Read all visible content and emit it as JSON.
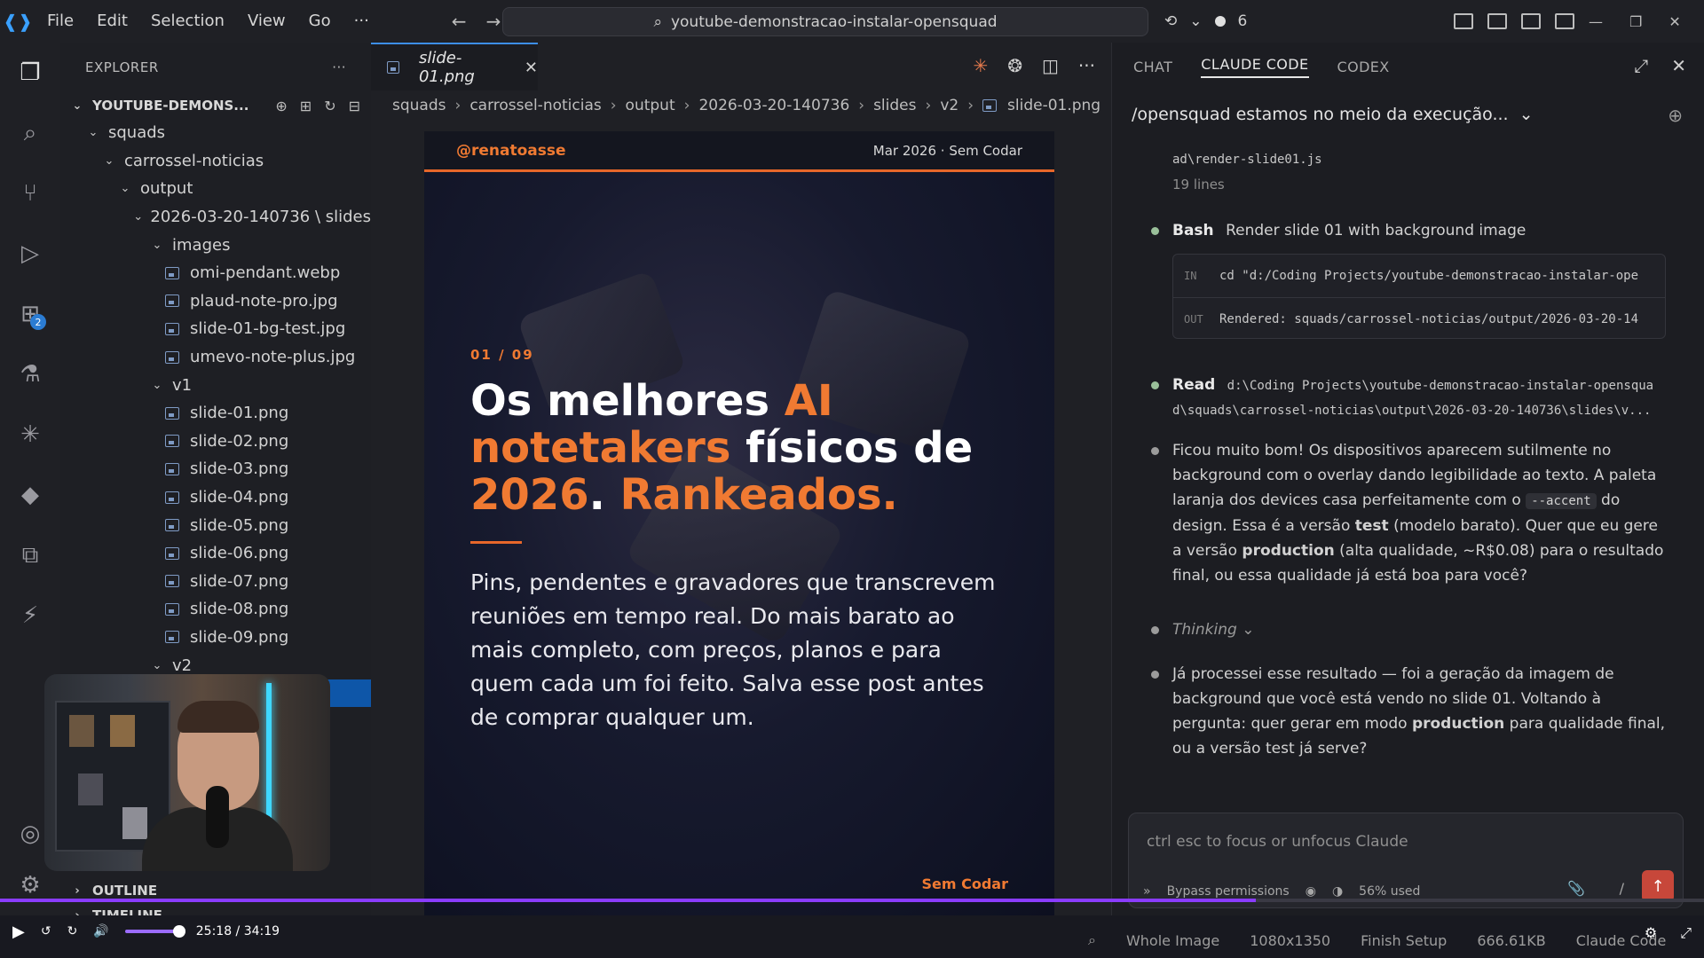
{
  "titlebar": {
    "menu": [
      "File",
      "Edit",
      "Selection",
      "View",
      "Go",
      "···"
    ],
    "search": "youtube-demonstracao-instalar-opensquad",
    "notifications": "6"
  },
  "explorer": {
    "title": "EXPLORER",
    "more": "···",
    "root": "YOUTUBE-DEMONS...",
    "tree": [
      {
        "label": "squads",
        "indent": 1,
        "kind": "folder"
      },
      {
        "label": "carrossel-noticias",
        "indent": 2,
        "kind": "folder"
      },
      {
        "label": "output",
        "indent": 3,
        "kind": "folder"
      },
      {
        "label": "2026-03-20-140736 \\ slides",
        "indent": 4,
        "kind": "folder"
      },
      {
        "label": "images",
        "indent": 5,
        "kind": "folder"
      },
      {
        "label": "omi-pendant.webp",
        "indent": 6,
        "kind": "file"
      },
      {
        "label": "plaud-note-pro.jpg",
        "indent": 6,
        "kind": "file"
      },
      {
        "label": "slide-01-bg-test.jpg",
        "indent": 6,
        "kind": "file"
      },
      {
        "label": "umevo-note-plus.jpg",
        "indent": 6,
        "kind": "file"
      },
      {
        "label": "v1",
        "indent": 5,
        "kind": "folder"
      },
      {
        "label": "slide-01.png",
        "indent": 6,
        "kind": "file"
      },
      {
        "label": "slide-02.png",
        "indent": 6,
        "kind": "file"
      },
      {
        "label": "slide-03.png",
        "indent": 6,
        "kind": "file"
      },
      {
        "label": "slide-04.png",
        "indent": 6,
        "kind": "file"
      },
      {
        "label": "slide-05.png",
        "indent": 6,
        "kind": "file"
      },
      {
        "label": "slide-06.png",
        "indent": 6,
        "kind": "file"
      },
      {
        "label": "slide-07.png",
        "indent": 6,
        "kind": "file"
      },
      {
        "label": "slide-08.png",
        "indent": 6,
        "kind": "file"
      },
      {
        "label": "slide-09.png",
        "indent": 6,
        "kind": "file"
      },
      {
        "label": "v2",
        "indent": 5,
        "kind": "folder"
      }
    ],
    "outline": "OUTLINE",
    "timeline": "TIMELINE"
  },
  "editor": {
    "tab": "slide-01.png",
    "breadcrumb": [
      "squads",
      "carrossel-noticias",
      "output",
      "2026-03-20-140736",
      "slides",
      "v2",
      "slide-01.png"
    ]
  },
  "slide": {
    "handle": "@renatoasse",
    "date": "Mar 2026 · Sem Codar",
    "counter": "01 / 09",
    "headline": {
      "p1": "Os melhores ",
      "a1": "AI",
      "a2": "notetakers",
      "p2": " físicos de",
      "a3": "2026",
      "p3": ". ",
      "a4": "Rankeados."
    },
    "body": "Pins, pendentes e gravadores que transcrevem reuniões em tempo real. Do mais barato ao mais completo, com preços, planos e para quem cada um foi feito. Salva esse post antes de comprar qualquer um.",
    "footer": "Sem Codar"
  },
  "chat": {
    "tabs": [
      "CHAT",
      "CLAUDE CODE",
      "CODEX"
    ],
    "session_title": "/opensquad estamos no meio da execução...",
    "msg0": {
      "path": "ad\\render-slide01.js",
      "meta": "19 lines"
    },
    "msg1": {
      "tool": "Bash",
      "desc": "Render slide 01 with background image",
      "in_tag": "IN",
      "in_cmd": "cd \"d:/Coding Projects/youtube-demonstracao-instalar-ope",
      "out_tag": "OUT",
      "out_text": "Rendered: squads/carrossel-noticias/output/2026-03-20-14"
    },
    "msg2": {
      "tool": "Read",
      "path": "d:\\Coding Projects\\youtube-demonstracao-instalar-opensqua",
      "path2": "d\\squads\\carrossel-noticias\\output\\2026-03-20-140736\\slides\\v..."
    },
    "msg3": {
      "t1": "Ficou muito bom! Os dispositivos aparecem sutilmente no background com o overlay dando legibilidade ao texto. A paleta laranja dos devices casa perfeitamente com o ",
      "code": "--accent",
      "t2": " do design. Essa é a versão ",
      "b1": "test",
      "t3": " (modelo barato). Quer que eu gere a versão ",
      "b2": "production",
      "t4": " (alta qualidade, ~R$0.08) para o resultado final, ou essa qualidade já está boa para você?"
    },
    "thinking": "Thinking",
    "msg4": {
      "t1": "Já processei esse resultado — foi a geração da imagem de background que você está vendo no slide 01. Voltando à pergunta: quer gerar em modo ",
      "b1": "production",
      "t2": " para qualidade final, ou a versão test já serve?"
    },
    "input_placeholder": "ctrl esc to focus or unfocus Claude",
    "bypass": "Bypass permissions",
    "usage": "56% used",
    "slash": "/"
  },
  "player": {
    "time": "25:18 / 34:19",
    "progress": 0.737
  },
  "statusbar": {
    "items": [
      "Whole Image",
      "1080x1350",
      "Finish Setup",
      "666.61KB",
      "Claude Code"
    ]
  }
}
